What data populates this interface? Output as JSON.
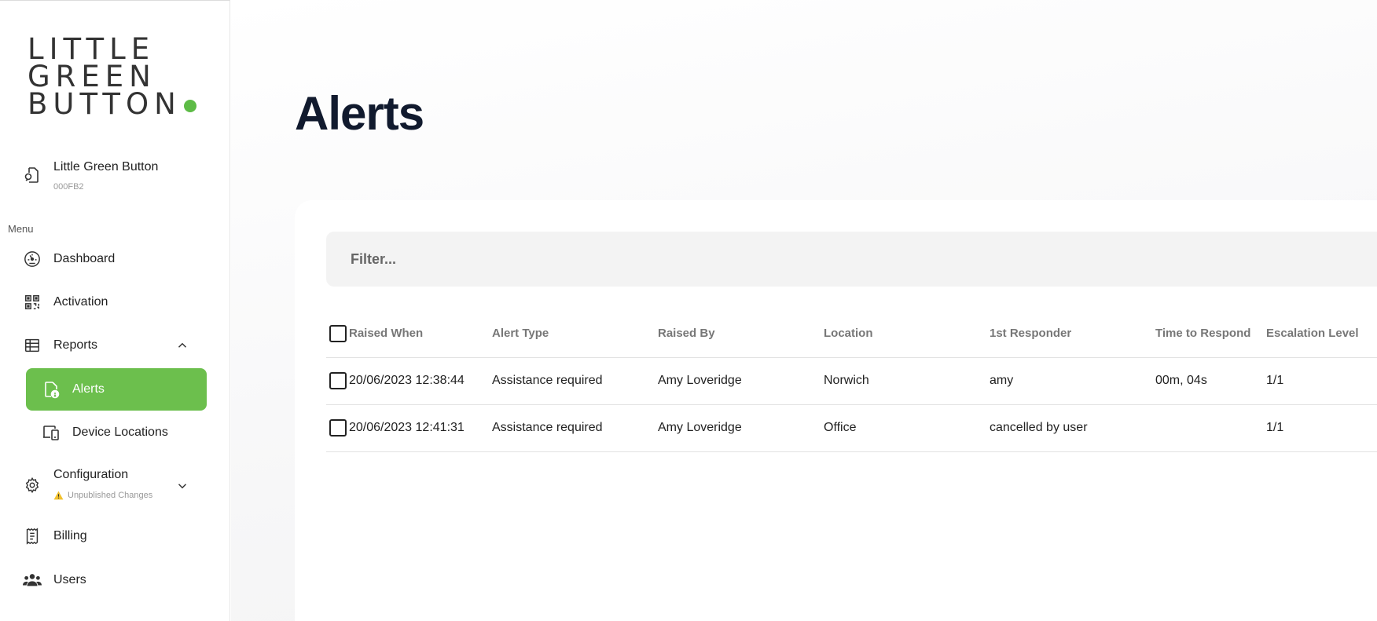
{
  "logo": {
    "line1": "LITTLE",
    "line2": "GREEN",
    "line3": "BUTTON",
    "dot_color": "#5dbb46"
  },
  "org": {
    "name": "Little Green Button",
    "code": "000FB2",
    "icon": "org-switch-icon"
  },
  "menu": {
    "label": "Menu",
    "dashboard": "Dashboard",
    "activation": "Activation",
    "reports": "Reports",
    "alerts": "Alerts",
    "device_locations": "Device Locations",
    "configuration": "Configuration",
    "configuration_note": "Unpublished Changes",
    "billing": "Billing",
    "users": "Users",
    "active_color": "#6cbf4d"
  },
  "page": {
    "title": "Alerts"
  },
  "filter": {
    "placeholder": "Filter..."
  },
  "table": {
    "headers": {
      "raised_when": "Raised When",
      "alert_type": "Alert Type",
      "raised_by": "Raised By",
      "location": "Location",
      "first_responder": "1st Responder",
      "time_to_respond": "Time to Respond",
      "escalation_level": "Escalation Level"
    },
    "rows": [
      {
        "raised_when": "20/06/2023 12:38:44",
        "alert_type": "Assistance required",
        "raised_by": "Amy Loveridge",
        "location": "Norwich",
        "first_responder": "amy",
        "time_to_respond": "00m, 04s",
        "escalation_level": "1/1"
      },
      {
        "raised_when": "20/06/2023 12:41:31",
        "alert_type": "Assistance required",
        "raised_by": "Amy Loveridge",
        "location": "Office",
        "first_responder": "cancelled by user",
        "time_to_respond": "",
        "escalation_level": "1/1"
      }
    ]
  }
}
